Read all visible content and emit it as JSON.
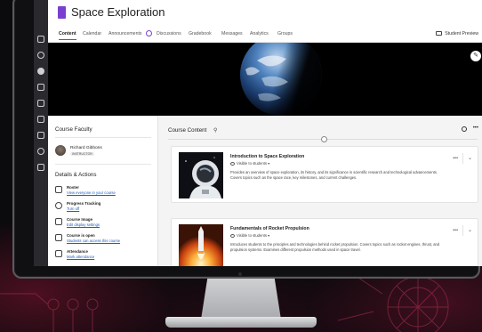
{
  "app": {
    "course_title": "Space Exploration"
  },
  "tabs": [
    {
      "label": "Content",
      "active": true
    },
    {
      "label": "Calendar"
    },
    {
      "label": "Announcements"
    },
    {
      "label": "Discussions"
    },
    {
      "label": "Gradebook"
    },
    {
      "label": "Messages"
    },
    {
      "label": "Analytics"
    },
    {
      "label": "Groups"
    }
  ],
  "header": {
    "student_preview_label": "Student Preview"
  },
  "banner": {
    "edit_icon": "pencil-icon"
  },
  "left_panel": {
    "faculty_heading": "Course Faculty",
    "faculty": {
      "name": "Richard Gibbons",
      "role": "INSTRUCTOR"
    },
    "details_heading": "Details & Actions",
    "items": [
      {
        "title": "Roster",
        "link": "View everyone in your course",
        "icon": "roster-icon"
      },
      {
        "title": "Progress Tracking",
        "link": "Turn off",
        "icon": "progress-icon"
      },
      {
        "title": "Course Image",
        "link": "Edit display settings",
        "icon": "image-icon"
      },
      {
        "title": "Course is open",
        "link": "Students can access this course",
        "icon": "lock-icon"
      },
      {
        "title": "Attendance",
        "link": "Mark attendance",
        "icon": "attendance-icon"
      }
    ]
  },
  "main": {
    "heading": "Course Content",
    "cards": [
      {
        "title": "Introduction to Space Exploration",
        "visibility": "Visible to students",
        "description": "Provides an overview of space exploration, its history, and its significance in scientific research and technological advancements. Covers topics such as the space race, key milestones, and current challenges."
      },
      {
        "title": "Fundamentals of Rocket Propulsion",
        "visibility": "Visible to students",
        "description": "Introduces students to the principles and technologies behind rocket propulsion. Covers topics such as rocket engines, thrust, and propulsion systems. Examines different propulsion methods used in space travel."
      }
    ]
  },
  "colors": {
    "accent": "#7a3fd1",
    "link": "#1f5fbf",
    "rail": "#2a2a2e"
  }
}
